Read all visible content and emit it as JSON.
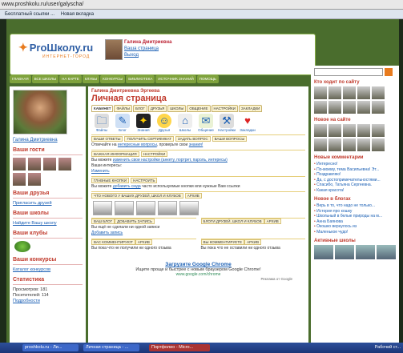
{
  "browser": {
    "address": "www.proshkolu.ru/user/galyscha/",
    "bookmarks": [
      "Бесплатный ссылки ...",
      "Новая вкладка"
    ]
  },
  "header": {
    "logo_text": "ProШколу.ru",
    "logo_tag": "ИНТЕРНЕТ-ГОРОД",
    "user_name": "Галина Дмитриевна",
    "links": [
      "Ваша страница",
      "Выход"
    ]
  },
  "nav": [
    "ГЛАВНАЯ",
    "ВСЕ ШКОЛЫ",
    "НА КАРТЕ",
    "КЛУБЫ",
    "КОНКУРСЫ",
    "БИБЛИОТЕКА",
    "ИСТОЧНИК ЗНАНИЙ",
    "ПОМОЩЬ"
  ],
  "left": {
    "name": "Галина Дмитриевна",
    "guests_title": "Ваши гости",
    "friends_title": "Ваши друзья",
    "friends_link": "Пригласить друзей",
    "schools_title": "Ваши школы",
    "schools_link": "Найдите Вашу школу",
    "clubs_title": "Ваши клубы",
    "contests_title": "Ваши конкурсы",
    "contests_link": "Каталог конкурсов",
    "stats_title": "Статистика",
    "views_label": "Просмотров:",
    "views": "181",
    "visitors_label": "Посетителей:",
    "visitors": "114",
    "details": "Подробности"
  },
  "main": {
    "owner": "Галина Дмитриевна Эргеева",
    "title": "Личная страница",
    "tabs": [
      "КАБИНЕТ",
      "ФАЙЛЫ",
      "БЛОГ",
      "ДРУЗЬЯ",
      "ШКОЛЫ",
      "ОБЩЕНИЕ",
      "НАСТРОЙКИ",
      "ЗАКЛАДКИ"
    ],
    "icons": [
      "Файлы",
      "Блог",
      "Знания",
      "Друзья",
      "Школы",
      "Общение",
      "Настройки",
      "Закладки"
    ],
    "q_tabs": [
      "ВАШИ ОТВЕТЫ",
      "ПОЛУЧИТЬ СЕРТИФИКАТ",
      "ЗАДАТЬ ВОПРОС",
      "ВАШИ ВОПРОСЫ"
    ],
    "q_text": "Отвечайте на",
    "q_link": "интересные вопросы",
    "q_text2": ", проверьте свои",
    "q_link2": "знания!",
    "info_tabs": [
      "ВАЖНАЯ ИНФОРМАЦИЯ",
      "НАСТРОЙКИ"
    ],
    "info_text": "Вы можете",
    "info_link": "изменить свои настройки (анкету, портрет, пароль, интересы)",
    "interests_label": "Ваши интересы:",
    "interests_link": "Изменить",
    "btn_tabs": [
      "ГЛАВНЫЕ КНОПКИ",
      "НАСТРОИТЬ"
    ],
    "btn_text": "Вы можете",
    "btn_link": "добавить сюда",
    "btn_text2": "часто используемые кнопки или нужные Вам ссылки",
    "news_tabs": [
      "ЧТО НОВОГО У ВАШИХ ДРУЗЕЙ, ШКОЛ И КЛУБОВ",
      "АРХИВ"
    ],
    "blog_tabs": [
      "ВАШ БЛОГ",
      "ДОБАВИТЬ ЗАПИСЬ"
    ],
    "blog_text": "Вы ещё не сделали ни одной записи",
    "blog_link": "Добавить запись",
    "friends_blog_tabs": [
      "БЛОГИ ДРУЗЕЙ, ШКОЛ И КЛУБОВ",
      "АРХИВ"
    ],
    "comments_in_tabs": [
      "ВАС КОММЕНТИРУЮТ",
      "АРХИВ"
    ],
    "comments_in_text": "Вы пока что не получили ни одного отзыва",
    "comments_out_tabs": [
      "ВЫ КОММЕНТИРУЕТЕ",
      "АРХИВ"
    ],
    "comments_out_text": "Вы пока что не оставили ни одного отзыва",
    "ad_title": "Загрузите Google Chrome",
    "ad_text": "Ищите проще и быстрее с новым браузером Google Chrome!",
    "ad_url": "www.google.com/chrome",
    "ad_by": "Реклама от Google"
  },
  "right": {
    "who_title": "Кто ходит по сайту",
    "new_title": "Новое на сайте",
    "comments_title": "Новые комментарии",
    "comments": [
      "Интересно!",
      "По-моему, тема Васильевна! Эт...",
      "Поздравляю!",
      "Да, с достопримечательностями...",
      "Спасибо, Татьяна Сергеевна.",
      "Какая красота!"
    ],
    "blogs_title": "Новое в блогах",
    "blogs": [
      "Верь в то, что надо не только...",
      "История про кошку",
      "Школьный в белые природы на м...",
      "Анна Баянова",
      "Окошко вернулось из",
      "Маленькое чудо!"
    ],
    "schools_title": "Активные школы"
  },
  "taskbar": {
    "items": [
      "proshkolu.ru - Ли...",
      "Личная страница - ...",
      "Портфолио - Micro..."
    ],
    "clock": "Рабочий ст..."
  }
}
